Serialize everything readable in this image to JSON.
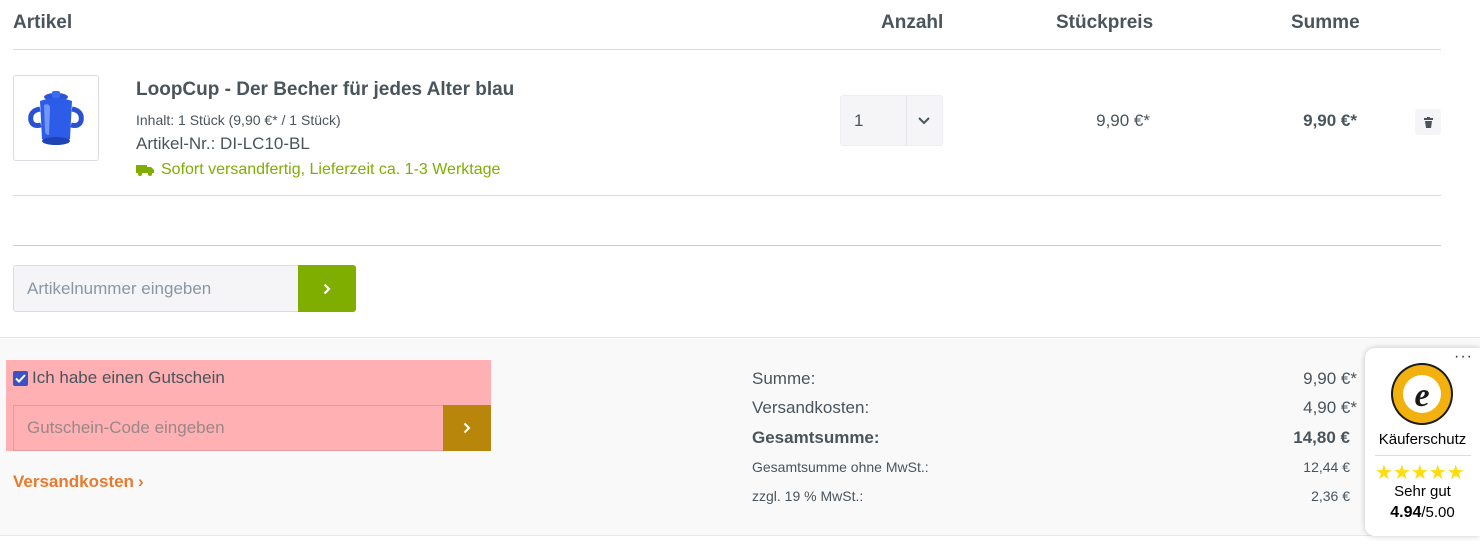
{
  "table": {
    "headers": {
      "article": "Artikel",
      "quantity": "Anzahl",
      "unit_price": "Stückpreis",
      "sum": "Summe"
    }
  },
  "item": {
    "title": "LoopCup - Der Becher für jedes Alter blau",
    "content": "Inhalt: 1 Stück (9,90 €* / 1 Stück)",
    "article_number": "Artikel-Nr.: DI-LC10-BL",
    "delivery": "Sofort versandfertig, Lieferzeit ca. 1-3 Werktage",
    "quantity": "1",
    "unit_price": "9,90 €*",
    "total": "9,90 €*",
    "thumbnail_icon": "blue-cup-image",
    "delivery_icon": "truck-icon",
    "remove_icon": "trash-icon"
  },
  "add_article": {
    "placeholder": "Artikelnummer eingeben",
    "button_icon": "chevron-right-icon"
  },
  "voucher": {
    "checkbox_label": "Ich habe einen Gutschein",
    "checked": true,
    "placeholder": "Gutschein-Code eingeben",
    "button_icon": "chevron-right-icon"
  },
  "shipping_link": {
    "label": "Versandkosten",
    "arrow": "›"
  },
  "summary": {
    "sum_label": "Summe:",
    "sum_value": "9,90 €*",
    "shipping_label": "Versandkosten:",
    "shipping_value": "4,90 €*",
    "total_label": "Gesamtsumme:",
    "total_value": "14,80 €",
    "net_label": "Gesamtsumme ohne MwSt.:",
    "net_value": "12,44 €",
    "vat_label": "zzgl. 19 % MwSt.:",
    "vat_value": "2,36 €"
  },
  "trusted_shops": {
    "menu": "···",
    "seal_icon": "trusted-shops-seal",
    "label": "Käuferschutz",
    "stars": "★★★★★",
    "rating_stars": 5,
    "grade": "Sehr gut",
    "score": "4.94",
    "score_max": "/5.00"
  },
  "colors": {
    "accent_green": "#7fae00",
    "link_orange": "#e97a2c",
    "highlight_red": "#ffb0b2",
    "voucher_button": "#b8860b",
    "text": "#4a545b"
  }
}
